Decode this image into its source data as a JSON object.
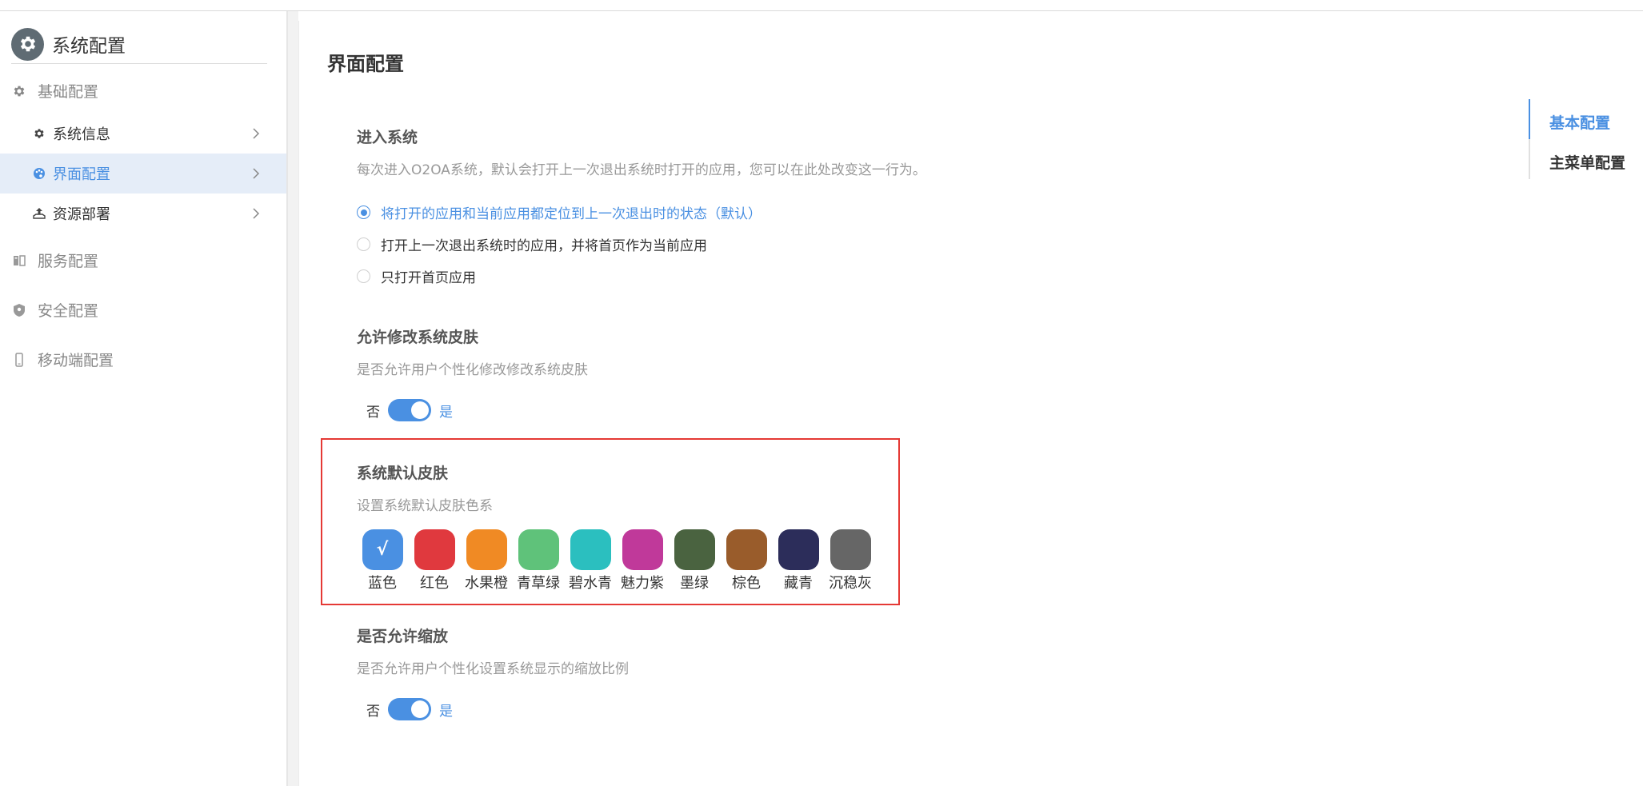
{
  "sidebar": {
    "title": "系统配置",
    "groups": [
      {
        "label": "基础配置",
        "icon": "gear-icon"
      },
      {
        "label": "服务配置",
        "icon": "server-icon"
      },
      {
        "label": "安全配置",
        "icon": "shield-icon"
      },
      {
        "label": "移动端配置",
        "icon": "mobile-icon"
      }
    ],
    "items": [
      {
        "label": "系统信息",
        "icon": "gear-icon",
        "active": false
      },
      {
        "label": "界面配置",
        "icon": "palette-icon",
        "active": true
      },
      {
        "label": "资源部署",
        "icon": "deploy-icon",
        "active": false
      }
    ]
  },
  "main": {
    "title": "界面配置",
    "enter_system": {
      "title": "进入系统",
      "desc": "每次进入O2OA系统，默认会打开上一次退出系统时打开的应用，您可以在此处改变这一行为。",
      "options": [
        {
          "label": "将打开的应用和当前应用都定位到上一次退出时的状态（默认）",
          "checked": true
        },
        {
          "label": "打开上一次退出系统时的应用，并将首页作为当前应用",
          "checked": false
        },
        {
          "label": "只打开首页应用",
          "checked": false
        }
      ]
    },
    "allow_skin": {
      "title": "允许修改系统皮肤",
      "desc": "是否允许用户个性化修改修改系统皮肤",
      "off_label": "否",
      "on_label": "是",
      "enabled": true
    },
    "default_skin": {
      "title": "系统默认皮肤",
      "desc": "设置系统默认皮肤色系",
      "check_mark": "√",
      "swatches": [
        {
          "label": "蓝色",
          "color": "#4a90e2",
          "selected": true
        },
        {
          "label": "红色",
          "color": "#e0393e",
          "selected": false
        },
        {
          "label": "水果橙",
          "color": "#f08a24",
          "selected": false
        },
        {
          "label": "青草绿",
          "color": "#5fc27a",
          "selected": false
        },
        {
          "label": "碧水青",
          "color": "#2bbfbf",
          "selected": false
        },
        {
          "label": "魅力紫",
          "color": "#c0399a",
          "selected": false
        },
        {
          "label": "墨绿",
          "color": "#4a6340",
          "selected": false
        },
        {
          "label": "棕色",
          "color": "#995c2b",
          "selected": false
        },
        {
          "label": "藏青",
          "color": "#2c2d5a",
          "selected": false
        },
        {
          "label": "沉稳灰",
          "color": "#666666",
          "selected": false
        }
      ]
    },
    "allow_zoom": {
      "title": "是否允许缩放",
      "desc": "是否允许用户个性化设置系统显示的缩放比例",
      "off_label": "否",
      "on_label": "是",
      "enabled": true
    }
  },
  "anchor_nav": {
    "items": [
      {
        "label": "基本配置",
        "active": true
      },
      {
        "label": "主菜单配置",
        "active": false
      }
    ]
  }
}
